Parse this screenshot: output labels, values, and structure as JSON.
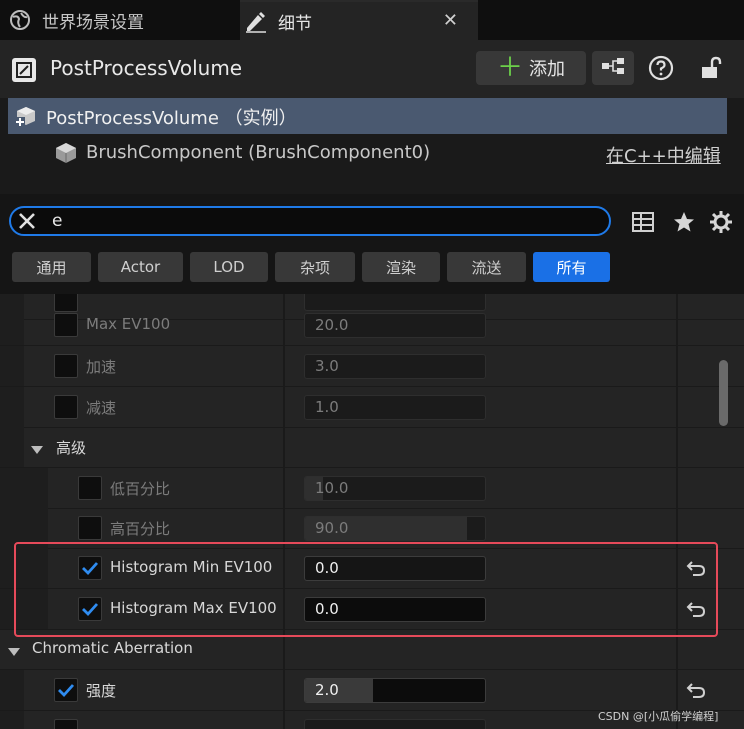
{
  "tabs": {
    "world_settings": "世界场景设置",
    "details": "细节",
    "close_symbol": "✕"
  },
  "header": {
    "actor_name": "PostProcessVolume",
    "add_label": "添加",
    "add_symbol": "＋"
  },
  "component_tree": {
    "root_label": "PostProcessVolume （实例）",
    "child_label": "BrushComponent (BrushComponent0)",
    "edit_in_cpp": "在C++中编辑"
  },
  "search": {
    "value": "e",
    "placeholder": ""
  },
  "filters": [
    {
      "label": "通用",
      "active": false
    },
    {
      "label": "Actor",
      "active": false
    },
    {
      "label": "LOD",
      "active": false
    },
    {
      "label": "杂项",
      "active": false
    },
    {
      "label": "渲染",
      "active": false
    },
    {
      "label": "流送",
      "active": false
    },
    {
      "label": "所有",
      "active": true
    }
  ],
  "properties": {
    "max_ev100": {
      "label": "Max EV100",
      "value": "20.0"
    },
    "speed_up": {
      "label": "加速",
      "value": "3.0"
    },
    "speed_down": {
      "label": "减速",
      "value": "1.0"
    },
    "advanced_section": "高级",
    "low_percent": {
      "label": "低百分比",
      "value": "10.0",
      "fill": 0.1
    },
    "high_percent": {
      "label": "高百分比",
      "value": "90.0",
      "fill": 0.9
    },
    "histogram_min": {
      "label": "Histogram Min EV100",
      "value": "0.0",
      "checked": true
    },
    "histogram_max": {
      "label": "Histogram Max EV100",
      "value": "0.0",
      "checked": true
    },
    "chromatic_section": "Chromatic Aberration",
    "intensity": {
      "label": "强度",
      "value": "2.0",
      "checked": true,
      "fill": 0.38
    }
  },
  "watermark": "CSDN @[小瓜偷学编程]",
  "colors": {
    "accent_blue": "#1a70e6",
    "selection_row": "#4a5970",
    "highlight_box": "#e64a5a",
    "add_plus": "#6cd04a"
  }
}
